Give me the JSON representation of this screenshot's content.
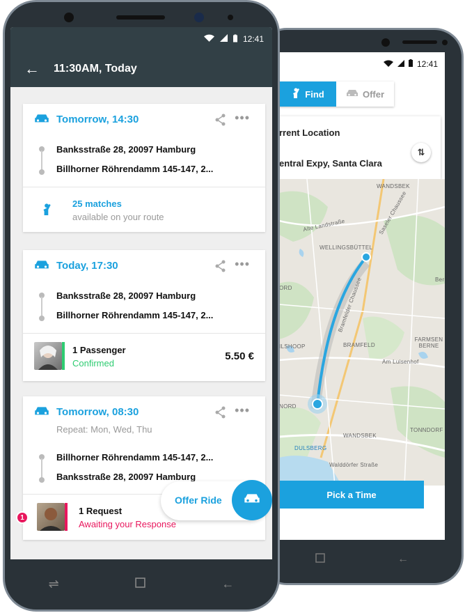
{
  "front": {
    "status_time": "12:41",
    "header_title": "11:30AM, Today",
    "cards": [
      {
        "time": "Tomorrow, 14:30",
        "from": "Banksstraße 28, 20097 Hamburg",
        "to": "Billhorner Röhrendamm 145-147, 2...",
        "matches": "25 matches",
        "matches_sub": "available on your route"
      },
      {
        "time": "Today, 17:30",
        "from": "Banksstraße 28, 20097 Hamburg",
        "to": "Billhorner Röhrendamm 145-147, 2...",
        "passenger": "1 Passenger",
        "status": "Confirmed",
        "price": "5.50 €"
      },
      {
        "time": "Tomorrow, 08:30",
        "repeat": "Repeat: Mon, Wed, Thu",
        "from": "Billhorner Röhrendamm 145-147, 2...",
        "to": "Banksstraße 28, 20097 Hamburg",
        "request": "1 Request",
        "request_status": "Awaiting your Response",
        "badge": "1"
      }
    ],
    "fab_label": "Offer Ride"
  },
  "back": {
    "status_time": "12:41",
    "tab_find": "Find",
    "tab_offer": "Offer",
    "from": "rrent Location",
    "to": "entral Expy, Santa Clara",
    "map_labels": {
      "wandsbek1": "WANDSBEK",
      "alte": "Alte Landstraße",
      "sasel": "Saseler Chaussee",
      "wellings": "WELLINGSBÜTTEL",
      "ord": "ORD",
      "bramfeld": "BRAMFELD",
      "ilshoop": "ILSHOOP",
      "farmsen": "FARMSEN BERNE",
      "lusenhof": "Am Luisenhof",
      "nord": "NORD",
      "wandsbek2": "WANDSBEK",
      "tonndorf": "TONNDORF",
      "dulsberg": "DULSBERG",
      "walddorfer": "Walddörfer Straße",
      "bramfelder": "Bramfelder Chaussee",
      "berne": "Berne"
    },
    "pick_time": "Pick a Time"
  },
  "colors": {
    "accent": "#1ba1de",
    "header": "#324046",
    "confirmed": "#2ecc71",
    "awaiting": "#e8175d"
  }
}
